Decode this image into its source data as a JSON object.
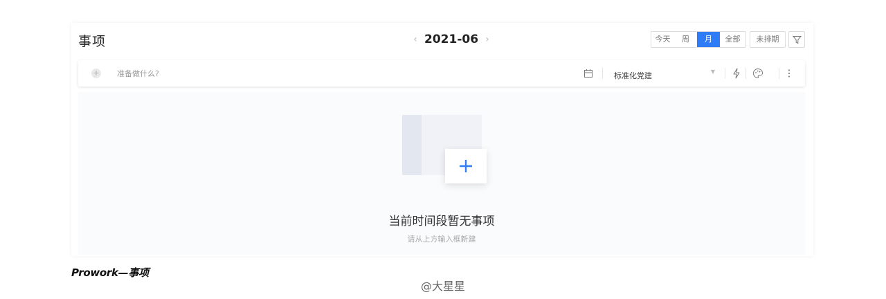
{
  "header": {
    "title": "事项",
    "month": "2021-06",
    "prev_icon": "chevron-left-icon",
    "next_icon": "chevron-right-icon",
    "views": [
      {
        "label": "今天",
        "active": false
      },
      {
        "label": "周",
        "active": false
      },
      {
        "label": "月",
        "active": true
      },
      {
        "label": "全部",
        "active": false
      }
    ],
    "unscheduled_label": "未排期",
    "filter_icon": "filter-icon"
  },
  "input_bar": {
    "placeholder": "准备做什么?",
    "project": "标准化党建",
    "icons": [
      "add-circle-icon",
      "calendar-icon",
      "caret-down-icon",
      "bolt-icon",
      "palette-icon",
      "more-vertical-icon"
    ]
  },
  "empty": {
    "title": "当前时间段暂无事项",
    "hint": "请从上方输入框新建"
  },
  "caption": "Prowork—事项",
  "watermark": "@大星星",
  "colors": {
    "accent": "#2f7df6",
    "panel_bg": "#fafbfd",
    "illustration": "#e2e7f0"
  }
}
